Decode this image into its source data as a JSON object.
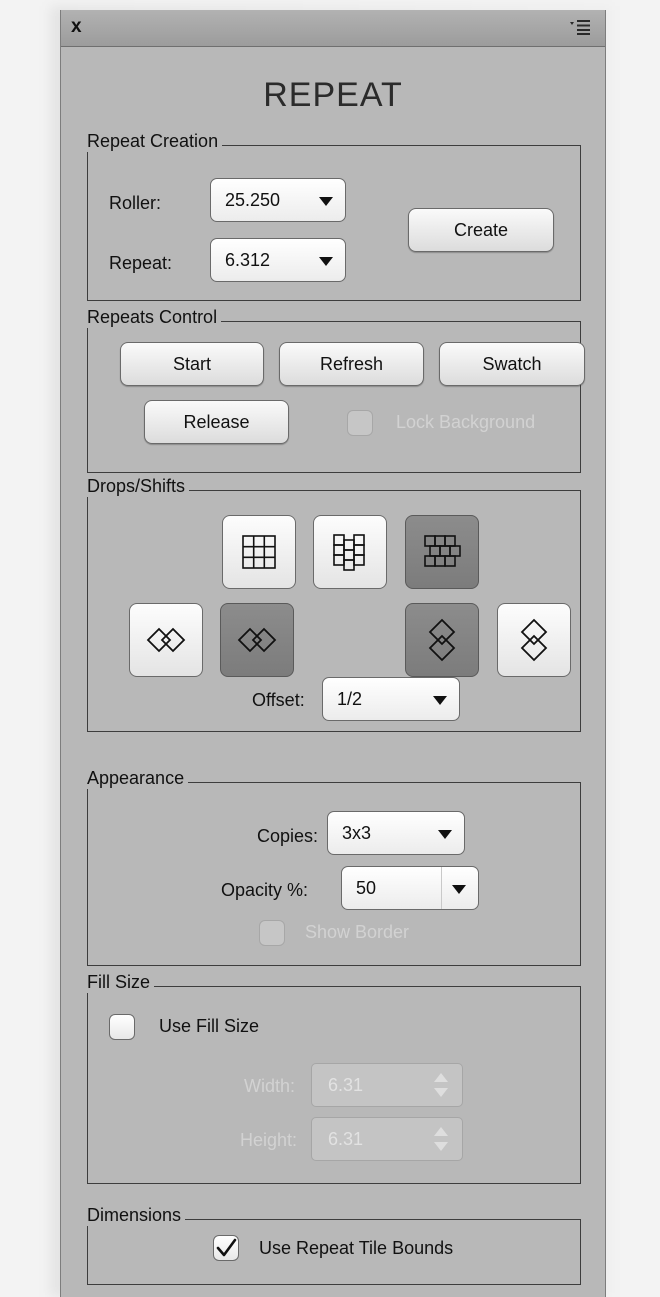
{
  "window": {
    "close_label": "x",
    "menu_icon": "panel-menu-icon",
    "title": "REPEAT"
  },
  "repeat_creation": {
    "label": "Repeat Creation",
    "roller_label": "Roller:",
    "roller_value": "25.250",
    "repeat_label": "Repeat:",
    "repeat_value": "6.312",
    "create_label": "Create"
  },
  "repeats_control": {
    "label": "Repeats Control",
    "start_label": "Start",
    "refresh_label": "Refresh",
    "swatch_label": "Swatch",
    "release_label": "Release",
    "lock_background_label": "Lock Background",
    "lock_background_checked": false
  },
  "drops_shifts": {
    "label": "Drops/Shifts",
    "tile_modes": [
      {
        "icon": "grid-tile-icon",
        "active": false
      },
      {
        "icon": "column-drop-tile-icon",
        "active": false
      },
      {
        "icon": "brick-tile-icon",
        "active": true
      }
    ],
    "shift_modes": [
      {
        "icon": "horizontal-overlap-diamonds-icon",
        "active": false
      },
      {
        "icon": "horizontal-reverse-diamonds-icon",
        "active": true
      },
      {
        "icon": "vertical-overlap-diamonds-icon",
        "active": true
      },
      {
        "icon": "vertical-reverse-diamonds-icon",
        "active": false
      }
    ],
    "offset_label": "Offset:",
    "offset_value": "1/2"
  },
  "appearance": {
    "label": "Appearance",
    "copies_label": "Copies:",
    "copies_value": "3x3",
    "opacity_label": "Opacity %:",
    "opacity_value": "50",
    "show_border_label": "Show Border",
    "show_border_checked": false
  },
  "fill_size": {
    "label": "Fill Size",
    "use_fill_size_label": "Use Fill Size",
    "use_fill_size_checked": false,
    "width_label": "Width:",
    "width_value": "6.31",
    "height_label": "Height:",
    "height_value": "6.31"
  },
  "dimensions": {
    "label": "Dimensions",
    "use_repeat_tile_bounds_label": "Use Repeat Tile Bounds",
    "use_repeat_tile_bounds_checked": true
  }
}
